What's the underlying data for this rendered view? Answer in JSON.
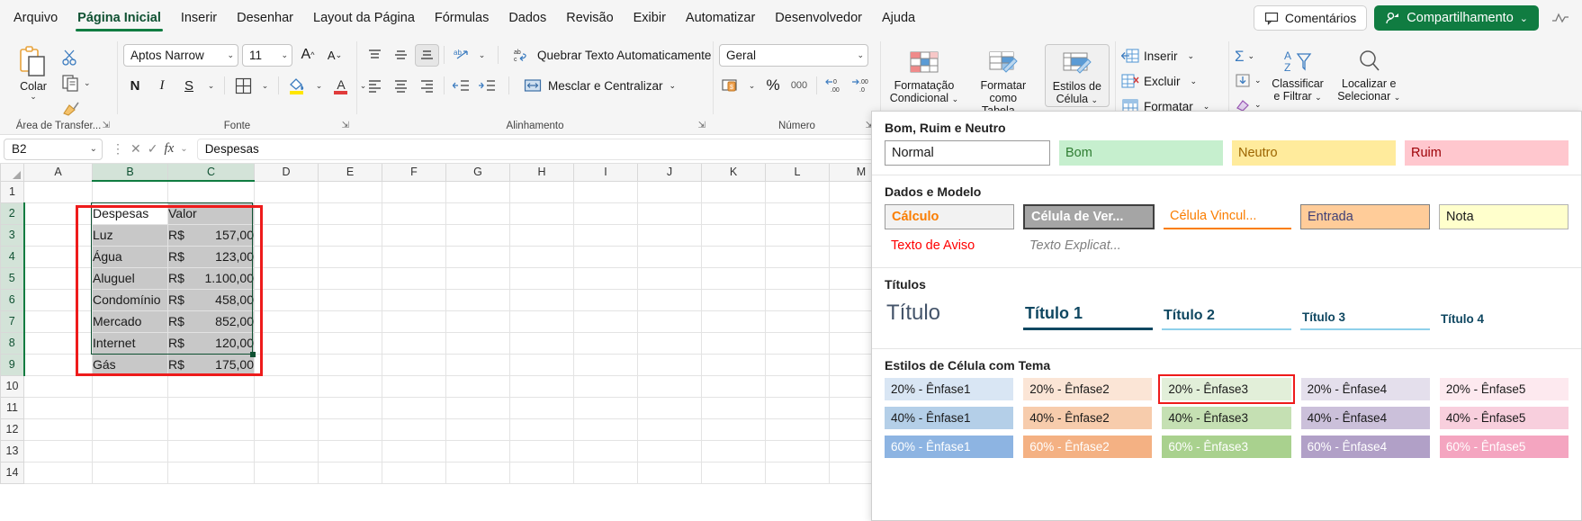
{
  "tabs": [
    {
      "label": "Arquivo",
      "active": false
    },
    {
      "label": "Página Inicial",
      "active": true
    },
    {
      "label": "Inserir",
      "active": false
    },
    {
      "label": "Desenhar",
      "active": false
    },
    {
      "label": "Layout da Página",
      "active": false
    },
    {
      "label": "Fórmulas",
      "active": false
    },
    {
      "label": "Dados",
      "active": false
    },
    {
      "label": "Revisão",
      "active": false
    },
    {
      "label": "Exibir",
      "active": false
    },
    {
      "label": "Automatizar",
      "active": false
    },
    {
      "label": "Desenvolvedor",
      "active": false
    },
    {
      "label": "Ajuda",
      "active": false
    }
  ],
  "titlebar": {
    "comments_label": "Comentários",
    "share_label": "Compartilhamento",
    "share_caret": "⌄"
  },
  "ribbon": {
    "clipboard": {
      "group_label": "Área de Transfer...",
      "paste_label": "Colar",
      "caret": "⌄"
    },
    "font": {
      "group_label": "Fonte",
      "font_name": "Aptos Narrow",
      "font_size": "11",
      "bold": "N",
      "italic": "I",
      "underline": "S",
      "caret": "⌄"
    },
    "alignment": {
      "group_label": "Alinhamento",
      "wrap_label": "Quebrar Texto Automaticamente",
      "merge_label": "Mesclar e Centralizar",
      "caret": "⌄"
    },
    "number": {
      "group_label": "Número",
      "format_value": "Geral",
      "percent": "%",
      "thousands": "000",
      "caret": "⌄"
    },
    "styles": {
      "conditional_line1": "Formatação",
      "conditional_line2": "Condicional",
      "table_line1": "Formatar como",
      "table_line2": "Tabela",
      "cellstyles_line1": "Estilos de",
      "cellstyles_line2": "Célula",
      "caret": "⌄"
    },
    "cells": {
      "insert_label": "Inserir",
      "delete_label": "Excluir",
      "format_label": "Formatar",
      "caret": "⌄"
    },
    "editing": {
      "sort_line1": "Classificar",
      "sort_line2": "e Filtrar",
      "find_line1": "Localizar e",
      "find_line2": "Selecionar",
      "caret": "⌄"
    }
  },
  "formula_bar": {
    "name_box": "B2",
    "name_caret": "⌄",
    "cancel": "✕",
    "confirm": "✓",
    "fx": "fx",
    "value": "Despesas"
  },
  "sheet": {
    "columns": [
      "A",
      "B",
      "C",
      "D",
      "E",
      "F",
      "G",
      "H",
      "I",
      "J",
      "K",
      "L",
      "M"
    ],
    "selected_columns": [
      "B",
      "C"
    ],
    "rows": [
      "1",
      "2",
      "3",
      "4",
      "5",
      "6",
      "7",
      "8",
      "9",
      "10",
      "11",
      "12",
      "13",
      "14"
    ],
    "selected_rows": [
      "2",
      "3",
      "4",
      "5",
      "6",
      "7",
      "8",
      "9"
    ],
    "table": {
      "header": [
        "Despesas",
        "Valor"
      ],
      "rows": [
        {
          "name": "Luz",
          "currency": "R$",
          "amount": "157,00"
        },
        {
          "name": "Água",
          "currency": "R$",
          "amount": "123,00"
        },
        {
          "name": "Aluguel",
          "currency": "R$",
          "amount": "1.100,00"
        },
        {
          "name": "Condomínio",
          "currency": "R$",
          "amount": "458,00"
        },
        {
          "name": "Mercado",
          "currency": "R$",
          "amount": "852,00"
        },
        {
          "name": "Internet",
          "currency": "R$",
          "amount": "120,00"
        },
        {
          "name": "Gás",
          "currency": "R$",
          "amount": "175,00"
        }
      ]
    }
  },
  "cell_styles_panel": {
    "sections": [
      {
        "title": "Bom, Ruim e Neutro",
        "items": [
          {
            "label": "Normal",
            "bg": "#ffffff",
            "fg": "#1a1a1a",
            "border": "#9a9a9a"
          },
          {
            "label": "Bom",
            "bg": "#c6efce",
            "fg": "#2f7d32",
            "border": ""
          },
          {
            "label": "Neutro",
            "bg": "#ffeb9c",
            "fg": "#9c6500",
            "border": ""
          },
          {
            "label": "Ruim",
            "bg": "#ffc7ce",
            "fg": "#9c0006",
            "border": ""
          }
        ]
      },
      {
        "title": "Dados e Modelo",
        "items": [
          {
            "label": "Cálculo",
            "bg": "#f2f2f2",
            "fg": "#fa7d00",
            "border": "#9a9a9a",
            "bold": true
          },
          {
            "label": "Célula de Ver...",
            "bg": "#a5a5a5",
            "fg": "#ffffff",
            "border": "#3f3f3f",
            "bold": true
          },
          {
            "label": "Célula Vincul...",
            "bg": "#ffffff",
            "fg": "#fa7d00",
            "border": "",
            "underline": "#fa7d00"
          },
          {
            "label": "Entrada",
            "bg": "#ffcc99",
            "fg": "#3f3f76",
            "border": "#7f7f7f"
          },
          {
            "label": "Nota",
            "bg": "#ffffcc",
            "fg": "#1a1a1a",
            "border": "#b2b2b2"
          }
        ],
        "items2": [
          {
            "label": "Texto de Aviso",
            "bg": "#ffffff",
            "fg": "#ff0000",
            "border": ""
          },
          {
            "label": "Texto Explicat...",
            "bg": "#ffffff",
            "fg": "#7f7f7f",
            "border": "",
            "italic": true
          }
        ]
      }
    ],
    "titles_section": {
      "title": "Títulos",
      "items": [
        {
          "label": "Título",
          "fg": "#44546a",
          "size": "24px",
          "rule": ""
        },
        {
          "label": "Título 1",
          "fg": "#0f4761",
          "size": "18px",
          "rule": "#0f4761",
          "bold": true
        },
        {
          "label": "Título 2",
          "fg": "#0f4761",
          "size": "16px",
          "rule": "#8ed0ea",
          "bold": true
        },
        {
          "label": "Título 3",
          "fg": "#0f4761",
          "size": "13.5px",
          "rule": "#8ed0ea",
          "bold": true
        },
        {
          "label": "Título 4",
          "fg": "#0f4761",
          "size": "13.5px",
          "rule": "",
          "bold": true
        }
      ]
    },
    "theme_section": {
      "title": "Estilos de Célula com Tema",
      "rows": [
        [
          {
            "label": "20% - Ênfase1",
            "bg": "#d9e6f4",
            "fg": "#1a1a1a",
            "highlight": false
          },
          {
            "label": "20% - Ênfase2",
            "bg": "#fbe5d6",
            "fg": "#1a1a1a",
            "highlight": false
          },
          {
            "label": "20% - Ênfase3",
            "bg": "#e2efd9",
            "fg": "#1a1a1a",
            "highlight": true
          },
          {
            "label": "20% - Ênfase4",
            "bg": "#e4dfec",
            "fg": "#1a1a1a",
            "highlight": false
          },
          {
            "label": "20% - Ênfase5",
            "bg": "#fde9ef",
            "fg": "#1a1a1a",
            "highlight": false
          }
        ],
        [
          {
            "label": "40% - Ênfase1",
            "bg": "#b4cfe8",
            "fg": "#1a1a1a",
            "highlight": false
          },
          {
            "label": "40% - Ênfase2",
            "bg": "#f7ccac",
            "fg": "#1a1a1a",
            "highlight": false
          },
          {
            "label": "40% - Ênfase3",
            "bg": "#c5e0b3",
            "fg": "#1a1a1a",
            "highlight": false
          },
          {
            "label": "40% - Ênfase4",
            "bg": "#cbc0da",
            "fg": "#1a1a1a",
            "highlight": false
          },
          {
            "label": "40% - Ênfase5",
            "bg": "#f8cfdd",
            "fg": "#1a1a1a",
            "highlight": false
          }
        ],
        [
          {
            "label": "60% - Ênfase1",
            "bg": "#8db4e2",
            "fg": "#ffffff",
            "highlight": false
          },
          {
            "label": "60% - Ênfase2",
            "bg": "#f4b183",
            "fg": "#ffffff",
            "highlight": false
          },
          {
            "label": "60% - Ênfase3",
            "bg": "#a9d18e",
            "fg": "#ffffff",
            "highlight": false
          },
          {
            "label": "60% - Ênfase4",
            "bg": "#b1a0c7",
            "fg": "#ffffff",
            "highlight": false
          },
          {
            "label": "60% - Ênfase5",
            "bg": "#f4a5c0",
            "fg": "#ffffff",
            "highlight": false
          }
        ]
      ]
    }
  },
  "colors": {
    "accent_green": "#107c41",
    "highlight_red": "#ee1b1b",
    "selection_green": "#0f5132"
  }
}
